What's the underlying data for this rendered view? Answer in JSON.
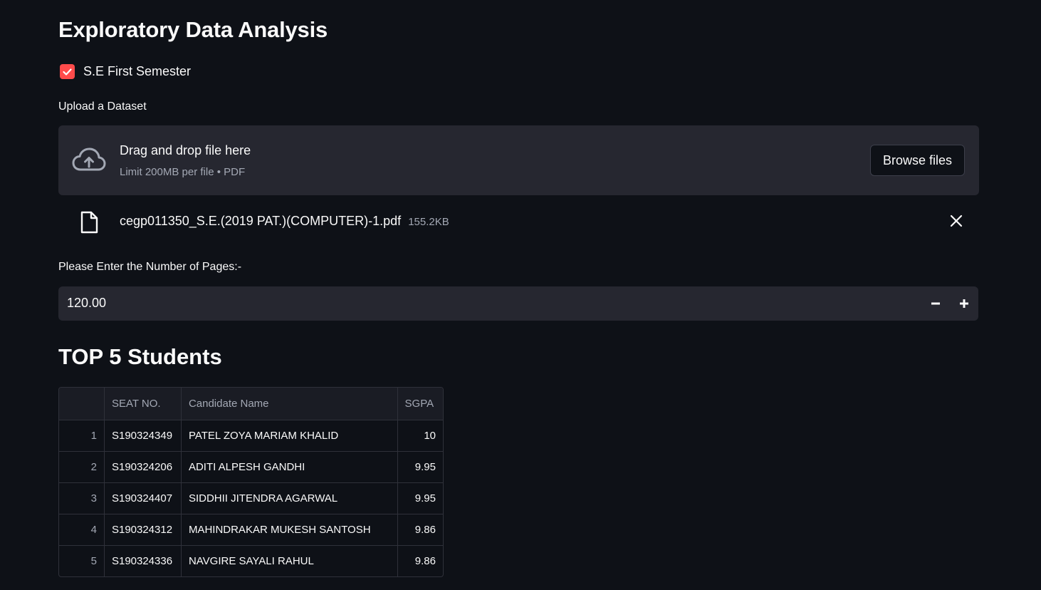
{
  "page": {
    "title": "Exploratory Data Analysis"
  },
  "checkbox": {
    "label": "S.E First Semester",
    "checked": true,
    "color": "#ff4b4b"
  },
  "uploader": {
    "label": "Upload a Dataset",
    "drop_text": "Drag and drop file here",
    "limit_text": "Limit 200MB per file • PDF",
    "browse_label": "Browse files",
    "icon": "cloud-upload-icon"
  },
  "uploaded_file": {
    "name": "cegp011350_S.E.(2019 PAT.)(COMPUTER)-1.pdf",
    "size": "155.2KB",
    "icon": "file-icon",
    "remove_icon": "close-icon"
  },
  "pages_input": {
    "label": "Please Enter the Number of Pages:-",
    "value": "120.00",
    "minus_label": "−",
    "plus_label": "+"
  },
  "top_students": {
    "title": "TOP 5 Students",
    "columns": [
      "",
      "SEAT NO.",
      "Candidate Name",
      "SGPA"
    ],
    "rows": [
      {
        "index": "1",
        "seat": "S190324349",
        "name": "PATEL ZOYA MARIAM KHALID",
        "sgpa": "10"
      },
      {
        "index": "2",
        "seat": "S190324206",
        "name": "ADITI ALPESH GANDHI",
        "sgpa": "9.95"
      },
      {
        "index": "3",
        "seat": "S190324407",
        "name": "SIDDHII JITENDRA AGARWAL",
        "sgpa": "9.95"
      },
      {
        "index": "4",
        "seat": "S190324312",
        "name": "MAHINDRAKAR MUKESH SANTOSH",
        "sgpa": "9.86"
      },
      {
        "index": "5",
        "seat": "S190324336",
        "name": "NAVGIRE SAYALI RAHUL",
        "sgpa": "9.86"
      }
    ]
  }
}
